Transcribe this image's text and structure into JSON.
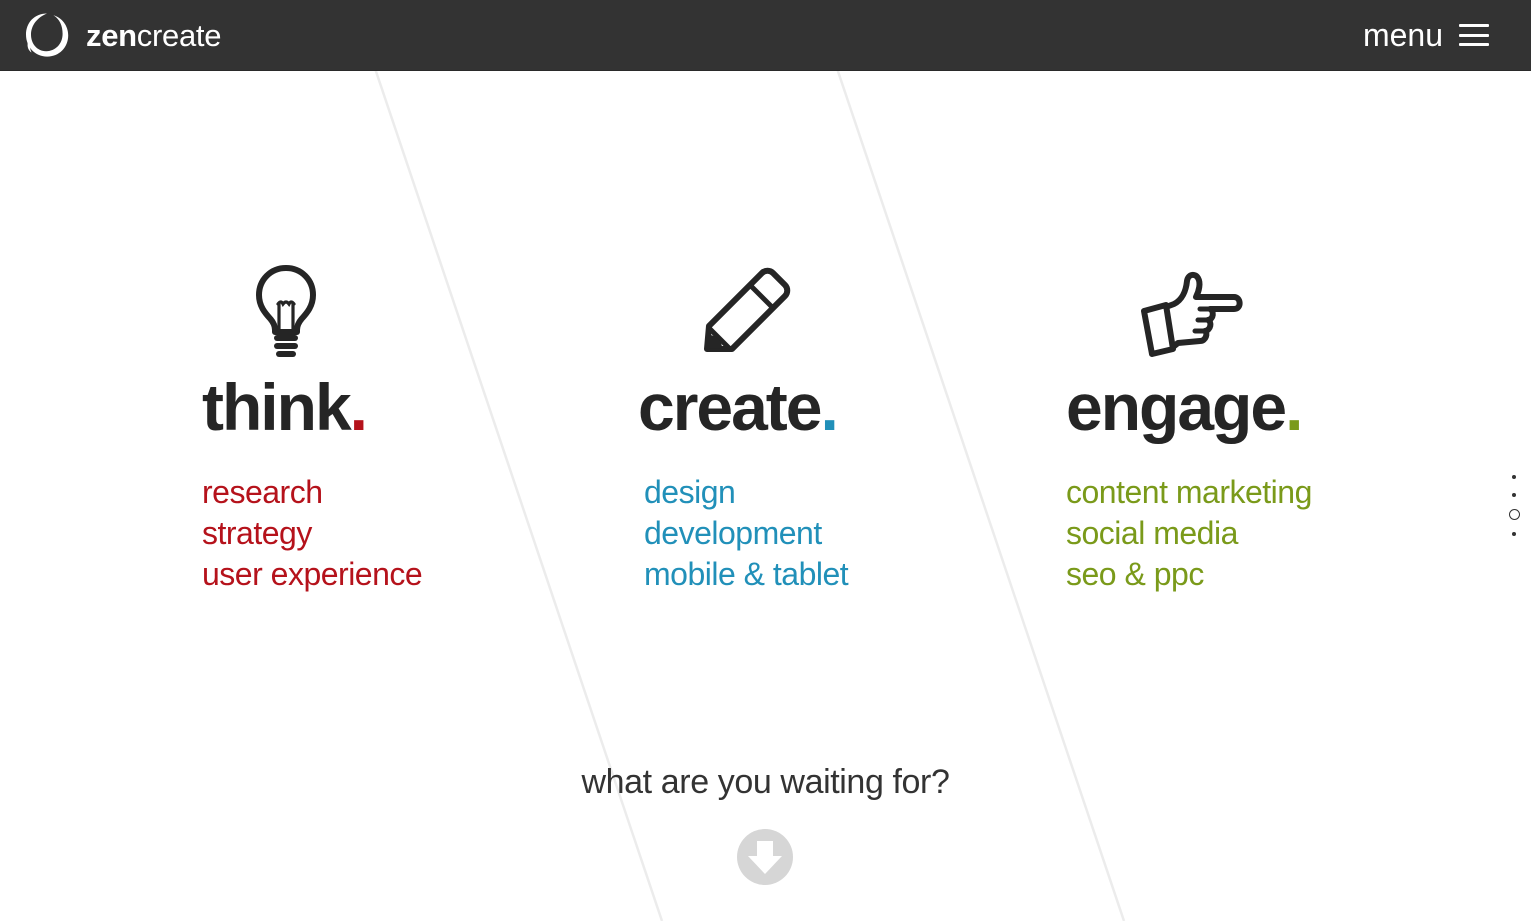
{
  "header": {
    "logo": {
      "bold": "zen",
      "light": "create"
    },
    "menu_label": "menu"
  },
  "columns": [
    {
      "key": "think",
      "icon": "lightbulb-icon",
      "title": "think",
      "accent": "#b5121b",
      "items": [
        "research",
        "strategy",
        "user experience"
      ]
    },
    {
      "key": "create",
      "icon": "pencil-icon",
      "title": "create",
      "accent": "#2190b9",
      "items": [
        "design",
        "development",
        "mobile & tablet"
      ]
    },
    {
      "key": "engage",
      "icon": "pointing-hand-icon",
      "title": "engage",
      "accent": "#7a9a1a",
      "items": [
        "content marketing",
        "social media",
        "seo & ppc"
      ]
    }
  ],
  "section_nav": {
    "count": 4,
    "active_index": 2
  },
  "cta": {
    "text": "what are you waiting for?",
    "icon": "arrow-down-circle-icon"
  },
  "colors": {
    "header_bg": "#333333",
    "title": "#252525",
    "scroll_button": "#d6d6d6"
  }
}
